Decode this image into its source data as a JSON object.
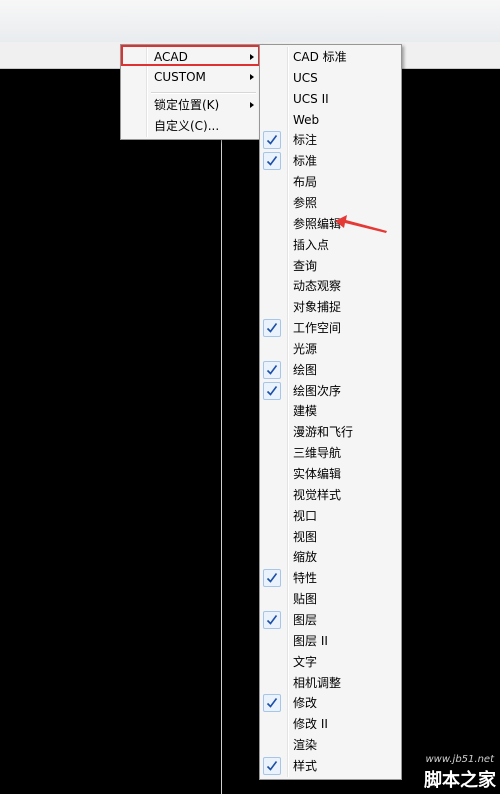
{
  "main_menu": {
    "items": [
      {
        "label": "ACAD",
        "submenu": true,
        "highlighted": true
      },
      {
        "label": "CUSTOM",
        "submenu": true
      },
      {
        "label": "锁定位置(K)",
        "submenu": true
      },
      {
        "label": "自定义(C)...",
        "submenu": false
      }
    ]
  },
  "sub_menu": {
    "items": [
      {
        "label": "CAD 标准",
        "checked": false
      },
      {
        "label": "UCS",
        "checked": false
      },
      {
        "label": "UCS II",
        "checked": false
      },
      {
        "label": "Web",
        "checked": false
      },
      {
        "label": "标注",
        "checked": true
      },
      {
        "label": "标准",
        "checked": true
      },
      {
        "label": "布局",
        "checked": false
      },
      {
        "label": "参照",
        "checked": false
      },
      {
        "label": "参照编辑",
        "checked": false
      },
      {
        "label": "插入点",
        "checked": false
      },
      {
        "label": "查询",
        "checked": false
      },
      {
        "label": "动态观察",
        "checked": false
      },
      {
        "label": "对象捕捉",
        "checked": false
      },
      {
        "label": "工作空间",
        "checked": true
      },
      {
        "label": "光源",
        "checked": false
      },
      {
        "label": "绘图",
        "checked": true
      },
      {
        "label": "绘图次序",
        "checked": true
      },
      {
        "label": "建模",
        "checked": false
      },
      {
        "label": "漫游和飞行",
        "checked": false
      },
      {
        "label": "三维导航",
        "checked": false
      },
      {
        "label": "实体编辑",
        "checked": false
      },
      {
        "label": "视觉样式",
        "checked": false
      },
      {
        "label": "视口",
        "checked": false
      },
      {
        "label": "视图",
        "checked": false
      },
      {
        "label": "缩放",
        "checked": false
      },
      {
        "label": "特性",
        "checked": true
      },
      {
        "label": "贴图",
        "checked": false
      },
      {
        "label": "图层",
        "checked": true
      },
      {
        "label": "图层 II",
        "checked": false
      },
      {
        "label": "文字",
        "checked": false
      },
      {
        "label": "相机调整",
        "checked": false
      },
      {
        "label": "修改",
        "checked": true
      },
      {
        "label": "修改 II",
        "checked": false
      },
      {
        "label": "渲染",
        "checked": false
      },
      {
        "label": "样式",
        "checked": true
      }
    ]
  },
  "watermark": {
    "url": "www.jb51.net",
    "text": "脚本之家"
  },
  "colors": {
    "highlight_border": "#e03131",
    "check_bg": "#eaf2fb",
    "check_mark": "#1c4fa8",
    "arrow": "#e53935"
  }
}
